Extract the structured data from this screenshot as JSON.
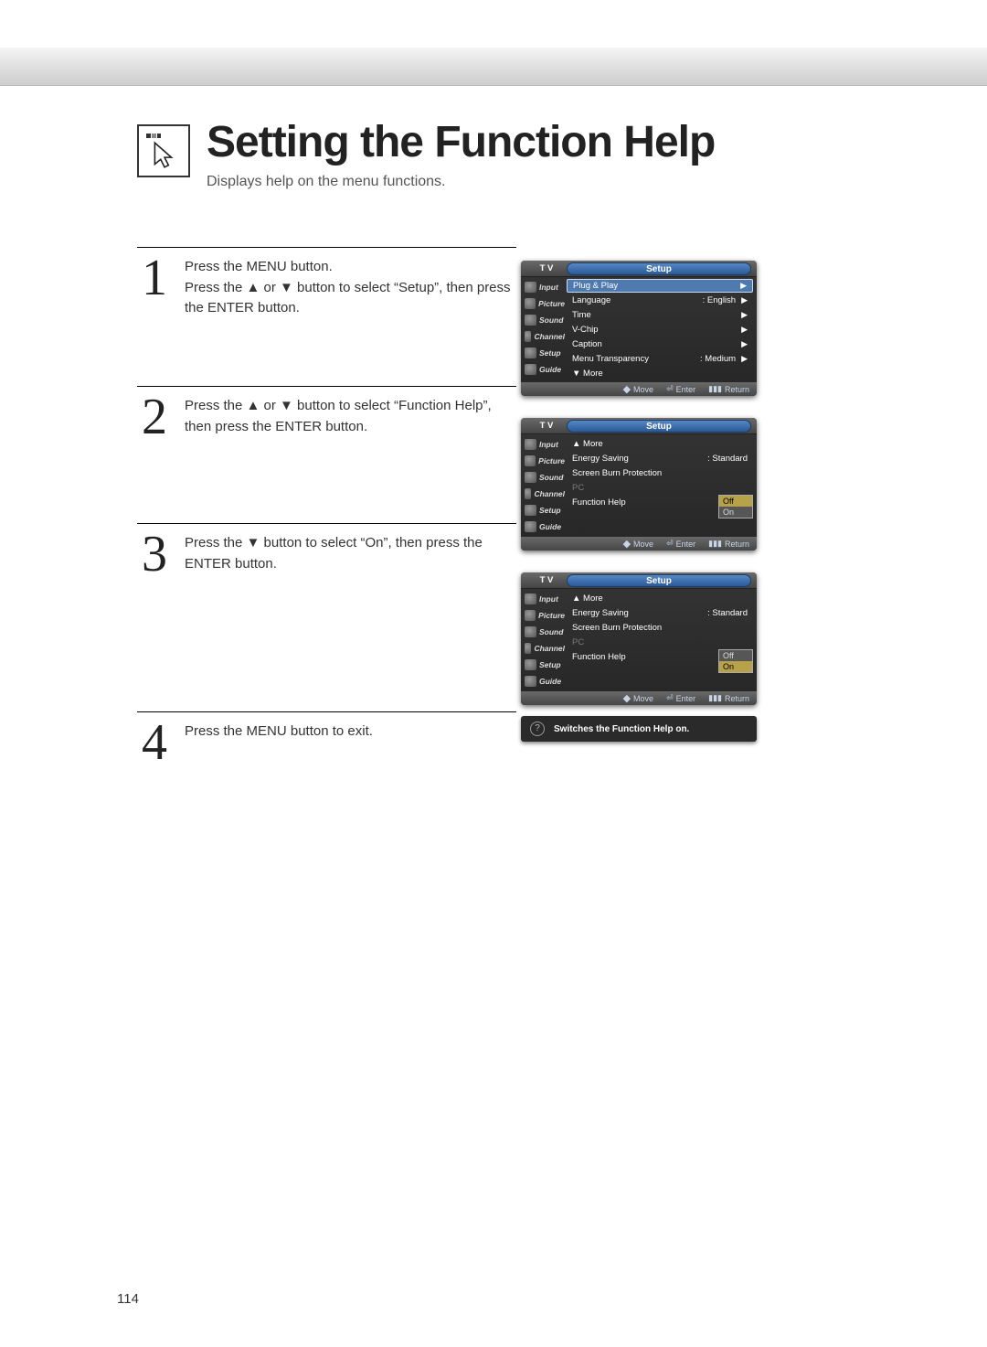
{
  "header": {
    "title": "Setting the Function Help",
    "subtitle": "Displays help on the menu functions."
  },
  "steps": [
    {
      "num": "1",
      "text": "Press the MENU button.\nPress the ▲ or ▼ button to select “Setup”, then press the ENTER button."
    },
    {
      "num": "2",
      "text": "Press the ▲ or ▼ button to select “Function Help”, then press the ENTER button."
    },
    {
      "num": "3",
      "text": "Press the ▼ button to select “On”, then press the ENTER button."
    },
    {
      "num": "4",
      "text": "Press the MENU button to exit."
    }
  ],
  "osd_common": {
    "tv_label": "T V",
    "title": "Setup",
    "side": [
      "Input",
      "Picture",
      "Sound",
      "Channel",
      "Setup",
      "Guide"
    ],
    "footer": {
      "move": "Move",
      "enter": "Enter",
      "return": "Return"
    }
  },
  "osd1": {
    "rows": [
      {
        "label": "Plug & Play",
        "value": "",
        "sel": true,
        "arrow": true
      },
      {
        "label": "Language",
        "value": ": English",
        "arrow": true
      },
      {
        "label": "Time",
        "value": "",
        "arrow": true
      },
      {
        "label": "V-Chip",
        "value": "",
        "arrow": true
      },
      {
        "label": "Caption",
        "value": "",
        "arrow": true
      },
      {
        "label": "Menu Transparency",
        "value": ": Medium",
        "arrow": true
      },
      {
        "label": "▼ More",
        "value": ""
      }
    ]
  },
  "osd2": {
    "rows": [
      {
        "label": "▲ More",
        "value": ""
      },
      {
        "label": "Energy Saving",
        "value": ": Standard"
      },
      {
        "label": "Screen Burn Protection",
        "value": ""
      },
      {
        "label": "PC",
        "value": "",
        "disabled": true
      },
      {
        "label": "Function Help",
        "value": ":",
        "optbox": true,
        "opts": [
          "Off",
          "On"
        ],
        "selopt": 0
      }
    ]
  },
  "osd3": {
    "rows": [
      {
        "label": "▲ More",
        "value": ""
      },
      {
        "label": "Energy Saving",
        "value": ": Standard"
      },
      {
        "label": "Screen Burn Protection",
        "value": ""
      },
      {
        "label": "PC",
        "value": "",
        "disabled": true
      },
      {
        "label": "Function Help",
        "value": ":",
        "optbox": true,
        "opts": [
          "Off",
          "On"
        ],
        "selopt": 1
      }
    ],
    "help_text": "Switches the Function Help on."
  },
  "page_number": "114"
}
